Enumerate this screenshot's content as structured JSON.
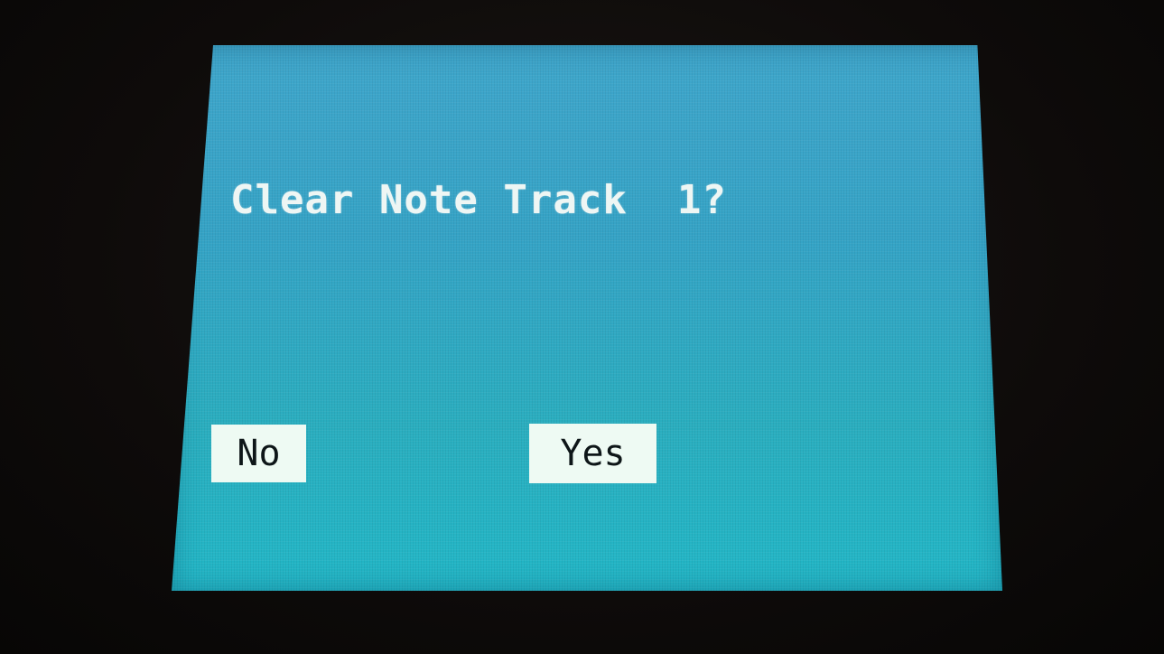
{
  "dialog": {
    "message": "Clear Note Track  1?",
    "no_label": "No",
    "yes_label": "Yes"
  },
  "colors": {
    "screen_top": "#3fa6cb",
    "screen_bottom": "#22b7c7",
    "text": "#eef6f4",
    "button_bg": "#eefaf3",
    "button_text": "#0e1618",
    "bezel": "#0b0908"
  }
}
